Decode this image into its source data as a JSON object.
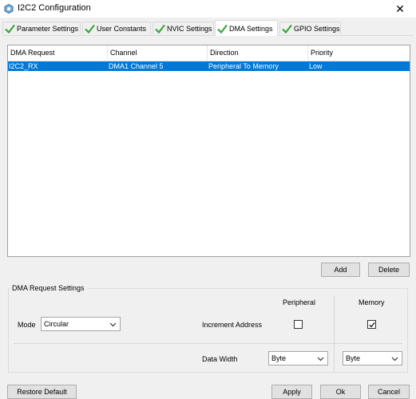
{
  "window": {
    "title": "I2C2 Configuration",
    "close_glyph": "✕"
  },
  "tabs": [
    {
      "label": "Parameter Settings",
      "icon": "check-icon"
    },
    {
      "label": "User Constants",
      "icon": "check-icon"
    },
    {
      "label": "NVIC Settings",
      "icon": "check-icon"
    },
    {
      "label": "DMA Settings",
      "icon": "check-icon",
      "active": true
    },
    {
      "label": "GPIO Settings",
      "icon": "check-icon"
    }
  ],
  "table": {
    "headers": [
      "DMA Request",
      "Channel",
      "Direction",
      "Priority"
    ],
    "rows": [
      [
        "I2C2_RX",
        "DMA1 Channel 5",
        "Peripheral To Memory",
        "Low"
      ]
    ]
  },
  "buttons": {
    "add": "Add",
    "delete": "Delete",
    "restore": "Restore Default",
    "apply": "Apply",
    "ok": "Ok",
    "cancel": "Cancel"
  },
  "request_settings": {
    "title": "DMA Request Settings",
    "peripheral_label": "Peripheral",
    "memory_label": "Memory",
    "mode_label": "Mode",
    "mode_value": "Circular",
    "increment_label": "Increment Address",
    "peripheral_increment": false,
    "memory_increment": true,
    "data_width_label": "Data Width",
    "peripheral_width": "Byte",
    "memory_width": "Byte"
  },
  "colors": {
    "selection": "#0078d7",
    "check_green": "#3aa63a"
  }
}
